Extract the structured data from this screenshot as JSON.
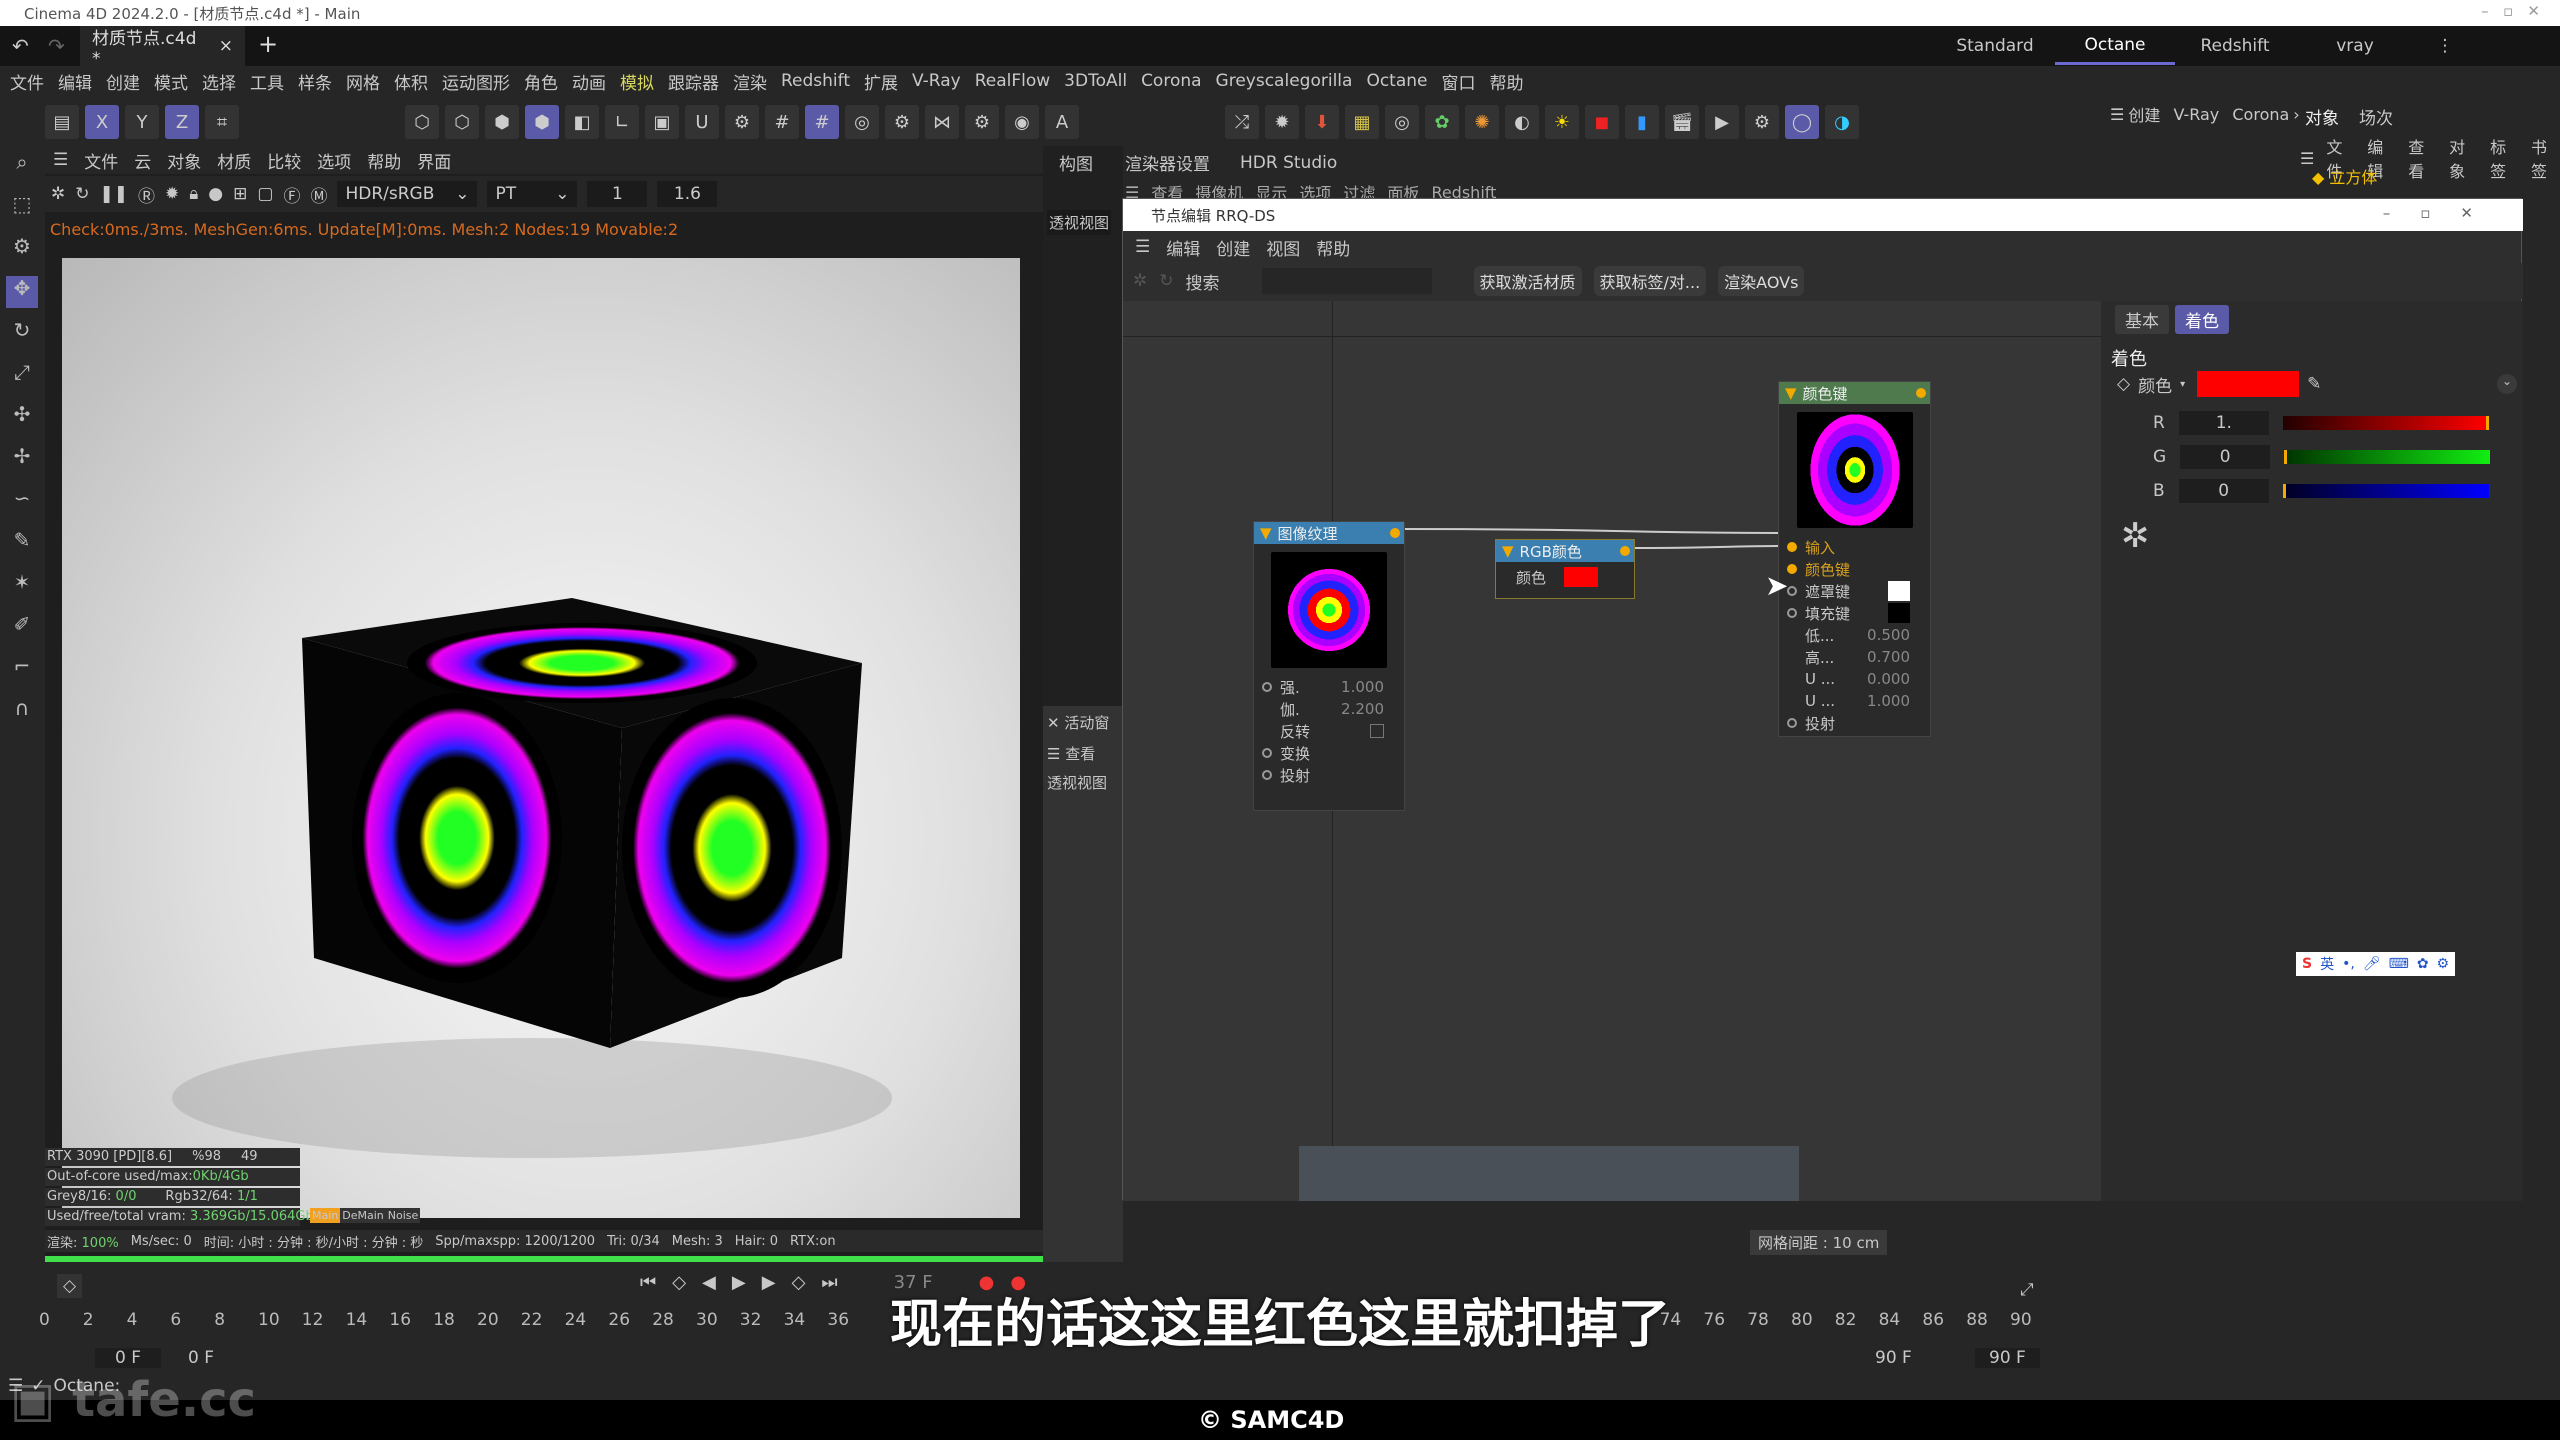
{
  "window": {
    "title": "Cinema 4D 2024.2.0 - [材质节点.c4d *] - Main"
  },
  "doc_tab": {
    "label": "材质节点.c4d *",
    "close": "×",
    "add": "+"
  },
  "layouts": [
    "Standard",
    "Octane",
    "Redshift",
    "vray"
  ],
  "active_layout": "Octane",
  "menu": [
    "文件",
    "编辑",
    "创建",
    "模式",
    "选择",
    "工具",
    "样条",
    "网格",
    "体积",
    "运动图形",
    "角色",
    "动画",
    "模拟",
    "跟踪器",
    "渲染",
    "Redshift",
    "扩展",
    "V-Ray",
    "RealFlow",
    "3DToAll",
    "Corona",
    "Greyscalegorilla",
    "Octane",
    "窗口",
    "帮助"
  ],
  "viewport": {
    "menu": [
      "文件",
      "云",
      "对象",
      "材质",
      "比较",
      "选项",
      "帮助",
      "界面"
    ],
    "color_space": "HDR/sRGB",
    "kernel": "PT",
    "val1": "1",
    "val2": "1.6",
    "check": "Check:0ms./3ms. MeshGen:6ms. Update[M]:0ms. Mesh:2 Nodes:19 Movable:2",
    "stats": {
      "gpu": "RTX 3090 [PD][8.6]",
      "pct": "%98",
      "n": "49",
      "ooc_label": "Out-of-core used/max:",
      "ooc": "0Kb/4Gb",
      "grey_label": "Grey8/16:",
      "grey": "0/0",
      "rgb_label": "Rgb32/64:",
      "rgb": "1/1",
      "vram_label": "Used/free/total vram:",
      "vram": "3.369Gb/15.064Gb/2",
      "tabs": [
        "Main",
        "DeMain",
        "Noise"
      ]
    },
    "render_status": {
      "render_label": "渲染:",
      "render": "100%",
      "mssec": "Ms/sec: 0",
      "time": "时间: 小时 : 分钟 : 秒/小时 : 分钟 : 秒",
      "spp": "Spp/maxspp: 1200/1200",
      "tri": "Tri: 0/34",
      "mesh": "Mesh: 3",
      "hair": "Hair: 0",
      "rtx": "RTX:on"
    },
    "progress": 1.0
  },
  "mid_panel": {
    "tabs": [
      "构图",
      "渲染器设置",
      "HDR Studio"
    ],
    "menu": [
      "查看",
      "摄像机",
      "显示",
      "选项",
      "过滤",
      "面板",
      "Redshift"
    ],
    "view": "透视视图",
    "active": "活动窗",
    "look": "查看",
    "view2": "透视视图"
  },
  "node_editor": {
    "title": "节点编辑 RRQ-DS",
    "menu": [
      "编辑",
      "创建",
      "视图",
      "帮助"
    ],
    "search_label": "搜索",
    "search_value": "",
    "buttons": [
      "获取激活材质",
      "获取标签/对...",
      "渲染AOVs"
    ],
    "nodes": {
      "image": {
        "title": "图像纹理",
        "rows": [
          {
            "label": "强.",
            "value": "1.000"
          },
          {
            "label": "伽.",
            "value": "2.200"
          },
          {
            "label": "反转",
            "value": ""
          },
          {
            "label": "变换",
            "value": ""
          },
          {
            "label": "投射",
            "value": ""
          }
        ]
      },
      "rgb": {
        "title": "RGB颜色",
        "label": "颜色",
        "color": "#ff0000"
      },
      "key": {
        "title": "颜色键",
        "rows": [
          {
            "label": "输入",
            "value": ""
          },
          {
            "label": "颜色键",
            "value": ""
          },
          {
            "label": "遮罩键",
            "value": ""
          },
          {
            "label": "填充键",
            "value": ""
          },
          {
            "label": "低...",
            "value": "0.500"
          },
          {
            "label": "高...",
            "value": "0.700"
          },
          {
            "label": "U ...",
            "value": "0.000"
          },
          {
            "label": "U ...",
            "value": "1.000"
          },
          {
            "label": "投射",
            "value": ""
          }
        ]
      }
    },
    "props": {
      "tabs": [
        "基本",
        "着色"
      ],
      "active_tab": "着色",
      "section": "着色",
      "color_label": "颜色",
      "color": "#ff0000",
      "R": "1.",
      "G": "0",
      "B": "0"
    }
  },
  "right_panel": {
    "tabs": [
      "对象",
      "场次"
    ],
    "menu": [
      "文件",
      "编辑",
      "查看",
      "对象",
      "标签",
      "书签"
    ],
    "object": "立方体",
    "render_menu": [
      "创建",
      "V-Ray",
      "Corona"
    ]
  },
  "timeline": {
    "ticks": [
      "0",
      "2",
      "4",
      "6",
      "8",
      "10",
      "12",
      "14",
      "16",
      "18",
      "20",
      "22",
      "24",
      "26",
      "28",
      "30",
      "32",
      "34",
      "36",
      "74",
      "76",
      "78",
      "80",
      "82",
      "84",
      "86",
      "88",
      "90"
    ],
    "current": "37 F",
    "start": "0 F",
    "start2": "0 F",
    "end": "90 F",
    "end2": "90 F",
    "grid": "网格间距 : 10 cm"
  },
  "subtitle": "现在的话这这里红色这里就扣掉了",
  "status": "Octane:",
  "watermark": "tafe.cc",
  "copyright": "© SAMC4D",
  "ime": "英"
}
